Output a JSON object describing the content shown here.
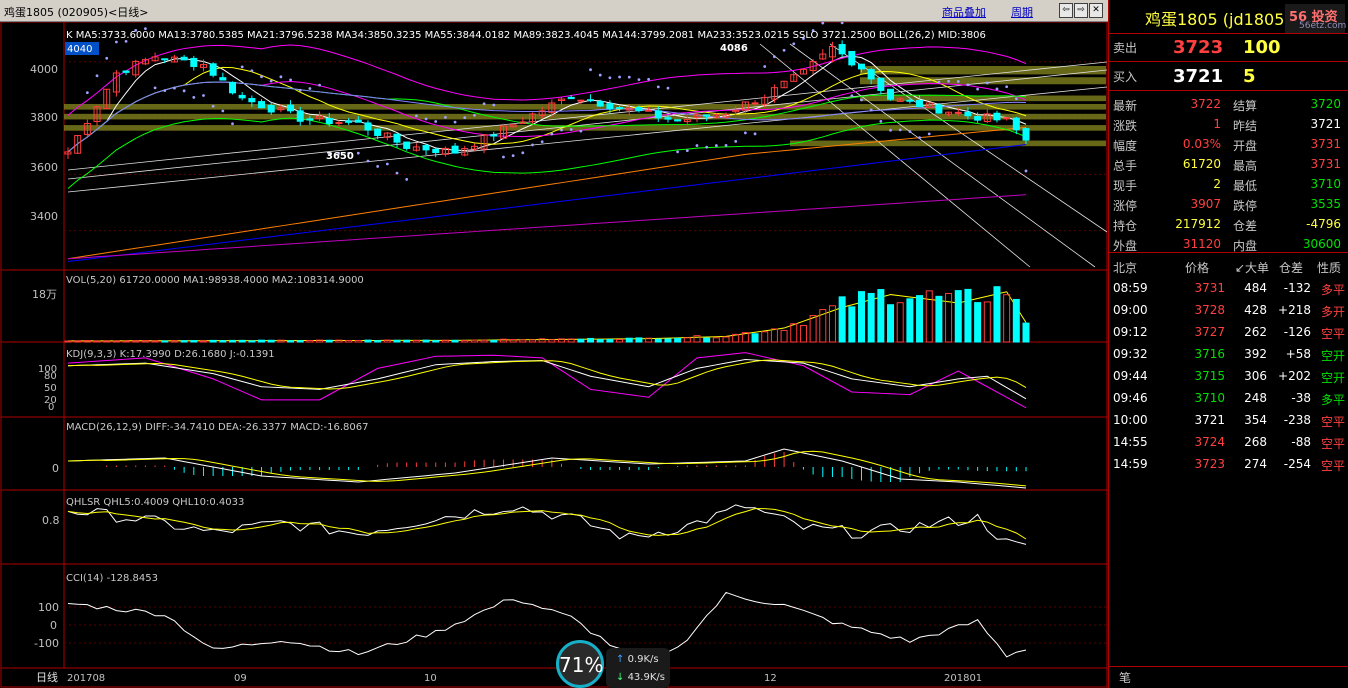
{
  "window": {
    "title": "鸡蛋1805 (020905)<日线>",
    "btn_overlay": "商品叠加",
    "btn_period": "周期",
    "nav_prev": "⇦",
    "nav_next": "⇨",
    "nav_close": "✕"
  },
  "main": {
    "indicator_text": "K  MA5:3733.6000  MA13:3780.5385  MA21:3796.5238  MA34:3850.3235  MA55:3844.0182  MA89:3823.4045  MA144:3799.2081  MA233:3523.0215  SSLO  3721.2500  BOLL(26,2)  MID:3806",
    "price_flag": "4040",
    "hi_label": "4086",
    "lo_label": "3650",
    "y_ticks": [
      "4000",
      "3800",
      "3600",
      "3400"
    ]
  },
  "vol": {
    "text": "VOL(5,20)  61720.0000  MA1:98938.4000  MA2:108314.9000",
    "unit": "18万"
  },
  "kdj": {
    "text": "KDJ(9,3,3)  K:17.3990  D:26.1680  J:-0.1391",
    "ticks": [
      "100",
      "80",
      "50",
      "20",
      "0"
    ]
  },
  "macd": {
    "text": "MACD(26,12,9)  DIFF:-34.7410  DEA:-26.3377  MACD:-16.8067",
    "ticks": [
      "0"
    ]
  },
  "qhlsr": {
    "text": "QHLSR  QHL5:0.4009  QHL10:0.4033",
    "ticks": [
      "0.8"
    ]
  },
  "cci": {
    "text": "CCI(14)  -128.8453",
    "ticks": [
      "100",
      "0",
      "-100"
    ]
  },
  "xaxis": {
    "label": "日线",
    "dates": [
      "201708",
      "09",
      "10",
      "12",
      "201801"
    ]
  },
  "side": {
    "title": "鸡蛋1805 (jd1805)",
    "logo": "56 投资",
    "logo_url": "56etz.com",
    "sell_label": "卖出",
    "sell_price": "3723",
    "sell_vol": "100",
    "buy_label": "买入",
    "buy_price": "3721",
    "buy_vol": "5",
    "stats": [
      {
        "l1": "最新",
        "v1": "3722",
        "c1": "red",
        "l2": "结算",
        "v2": "3720",
        "c2": "grn"
      },
      {
        "l1": "涨跌",
        "v1": "1",
        "c1": "red",
        "l2": "昨结",
        "v2": "3721",
        "c2": "wht"
      },
      {
        "l1": "幅度",
        "v1": "0.03%",
        "c1": "red",
        "l2": "开盘",
        "v2": "3731",
        "c2": "red"
      },
      {
        "l1": "总手",
        "v1": "61720",
        "c1": "yel",
        "l2": "最高",
        "v2": "3731",
        "c2": "red"
      },
      {
        "l1": "现手",
        "v1": "2",
        "c1": "yel",
        "l2": "最低",
        "v2": "3710",
        "c2": "grn"
      },
      {
        "l1": "涨停",
        "v1": "3907",
        "c1": "red",
        "l2": "跌停",
        "v2": "3535",
        "c2": "grn"
      },
      {
        "l1": "持仓",
        "v1": "217912",
        "c1": "yel",
        "l2": "仓差",
        "v2": "-4796",
        "c2": "yel"
      },
      {
        "l1": "外盘",
        "v1": "31120",
        "c1": "red",
        "l2": "内盘",
        "v2": "30600",
        "c2": "grn"
      }
    ],
    "ticks_header": [
      "北京",
      "价格",
      "↙大单",
      "仓差",
      "性质"
    ],
    "ticks": [
      {
        "t": "08:59",
        "p": "3731",
        "pc": "red",
        "v": "484",
        "d": "-132",
        "n": "多平",
        "nc": "red"
      },
      {
        "t": "09:00",
        "p": "3728",
        "pc": "red",
        "v": "428",
        "d": "+218",
        "n": "多开",
        "nc": "red"
      },
      {
        "t": "09:12",
        "p": "3727",
        "pc": "red",
        "v": "262",
        "d": "-126",
        "n": "空平",
        "nc": "red"
      },
      {
        "t": "09:32",
        "p": "3716",
        "pc": "grn",
        "v": "392",
        "d": "+58",
        "n": "空开",
        "nc": "grn"
      },
      {
        "t": "09:44",
        "p": "3715",
        "pc": "grn",
        "v": "306",
        "d": "+202",
        "n": "空开",
        "nc": "grn"
      },
      {
        "t": "09:46",
        "p": "3710",
        "pc": "grn",
        "v": "248",
        "d": "-38",
        "n": "多平",
        "nc": "grn"
      },
      {
        "t": "10:00",
        "p": "3721",
        "pc": "wht",
        "v": "354",
        "d": "-238",
        "n": "空平",
        "nc": "red"
      },
      {
        "t": "14:55",
        "p": "3724",
        "pc": "red",
        "v": "268",
        "d": "-88",
        "n": "空平",
        "nc": "red"
      },
      {
        "t": "14:59",
        "p": "3723",
        "pc": "red",
        "v": "274",
        "d": "-254",
        "n": "空平",
        "nc": "red"
      }
    ],
    "bottom_label": "笔"
  },
  "overlay": {
    "percent": "71%",
    "up": "0.9K/s",
    "down": "43.9K/s"
  },
  "colors": {
    "up": "#ff3c3c",
    "down": "#00ffff",
    "ma5": "#ffffff",
    "ma13": "#ffff00",
    "ma21": "#ff00ff",
    "ma34": "#00ff00",
    "ma55": "#8080ff",
    "ma89": "#ff8000",
    "ma144": "#0000ff",
    "ma233": "#c000c0",
    "band": "#8a8a20"
  },
  "chart_data": {
    "type": "candlestick",
    "title": "鸡蛋1805 (020905) 日线",
    "n": 100,
    "anchors": [
      [
        0,
        3680
      ],
      [
        5,
        3960
      ],
      [
        9,
        4020
      ],
      [
        14,
        3990
      ],
      [
        18,
        3870
      ],
      [
        24,
        3800
      ],
      [
        30,
        3780
      ],
      [
        35,
        3700
      ],
      [
        40,
        3680
      ],
      [
        45,
        3760
      ],
      [
        52,
        3880
      ],
      [
        58,
        3830
      ],
      [
        63,
        3790
      ],
      [
        68,
        3820
      ],
      [
        72,
        3880
      ],
      [
        76,
        3960
      ],
      [
        79,
        4050
      ],
      [
        82,
        3980
      ],
      [
        85,
        3870
      ],
      [
        89,
        3840
      ],
      [
        93,
        3810
      ],
      [
        97,
        3790
      ],
      [
        99,
        3722
      ]
    ],
    "price_range": [
      3260,
      4120
    ],
    "vol_anchors": [
      [
        0,
        0.02
      ],
      [
        40,
        0.03
      ],
      [
        60,
        0.06
      ],
      [
        68,
        0.1
      ],
      [
        74,
        0.25
      ],
      [
        80,
        0.62
      ],
      [
        85,
        0.85
      ],
      [
        92,
        0.7
      ],
      [
        97,
        0.9
      ],
      [
        99,
        0.35
      ]
    ],
    "kdj_k": [
      [
        0,
        80
      ],
      [
        8,
        85
      ],
      [
        15,
        65
      ],
      [
        20,
        40
      ],
      [
        26,
        35
      ],
      [
        32,
        55
      ],
      [
        38,
        82
      ],
      [
        44,
        88
      ],
      [
        49,
        90
      ],
      [
        54,
        60
      ],
      [
        60,
        40
      ],
      [
        65,
        75
      ],
      [
        70,
        92
      ],
      [
        76,
        85
      ],
      [
        81,
        55
      ],
      [
        87,
        40
      ],
      [
        92,
        55
      ],
      [
        95,
        60
      ],
      [
        99,
        17
      ]
    ],
    "kdj_j": [
      [
        0,
        85
      ],
      [
        8,
        95
      ],
      [
        15,
        55
      ],
      [
        20,
        15
      ],
      [
        26,
        15
      ],
      [
        32,
        75
      ],
      [
        38,
        98
      ],
      [
        44,
        100
      ],
      [
        49,
        95
      ],
      [
        54,
        35
      ],
      [
        60,
        20
      ],
      [
        65,
        95
      ],
      [
        70,
        105
      ],
      [
        76,
        80
      ],
      [
        81,
        30
      ],
      [
        87,
        25
      ],
      [
        92,
        70
      ],
      [
        95,
        40
      ],
      [
        99,
        -0.1
      ]
    ],
    "macd_diff": [
      [
        0,
        10
      ],
      [
        10,
        15
      ],
      [
        20,
        -15
      ],
      [
        30,
        -25
      ],
      [
        40,
        -10
      ],
      [
        50,
        15
      ],
      [
        60,
        5
      ],
      [
        70,
        10
      ],
      [
        74,
        30
      ],
      [
        80,
        10
      ],
      [
        86,
        -20
      ],
      [
        92,
        -25
      ],
      [
        99,
        -35
      ]
    ],
    "cci": [
      [
        0,
        120
      ],
      [
        10,
        60
      ],
      [
        15,
        -140
      ],
      [
        22,
        -80
      ],
      [
        30,
        -160
      ],
      [
        38,
        -40
      ],
      [
        46,
        150
      ],
      [
        52,
        40
      ],
      [
        58,
        -180
      ],
      [
        63,
        -130
      ],
      [
        68,
        170
      ],
      [
        74,
        110
      ],
      [
        80,
        0
      ],
      [
        87,
        -90
      ],
      [
        94,
        20
      ],
      [
        97,
        -170
      ],
      [
        99,
        -129
      ]
    ],
    "qhlsr": [
      [
        0,
        0.78
      ],
      [
        8,
        0.68
      ],
      [
        15,
        0.55
      ],
      [
        22,
        0.65
      ],
      [
        30,
        0.55
      ],
      [
        38,
        0.7
      ],
      [
        46,
        0.82
      ],
      [
        52,
        0.7
      ],
      [
        58,
        0.5
      ],
      [
        64,
        0.62
      ],
      [
        70,
        0.82
      ],
      [
        76,
        0.6
      ],
      [
        82,
        0.55
      ],
      [
        88,
        0.62
      ],
      [
        94,
        0.7
      ],
      [
        97,
        0.45
      ],
      [
        99,
        0.4
      ]
    ]
  }
}
